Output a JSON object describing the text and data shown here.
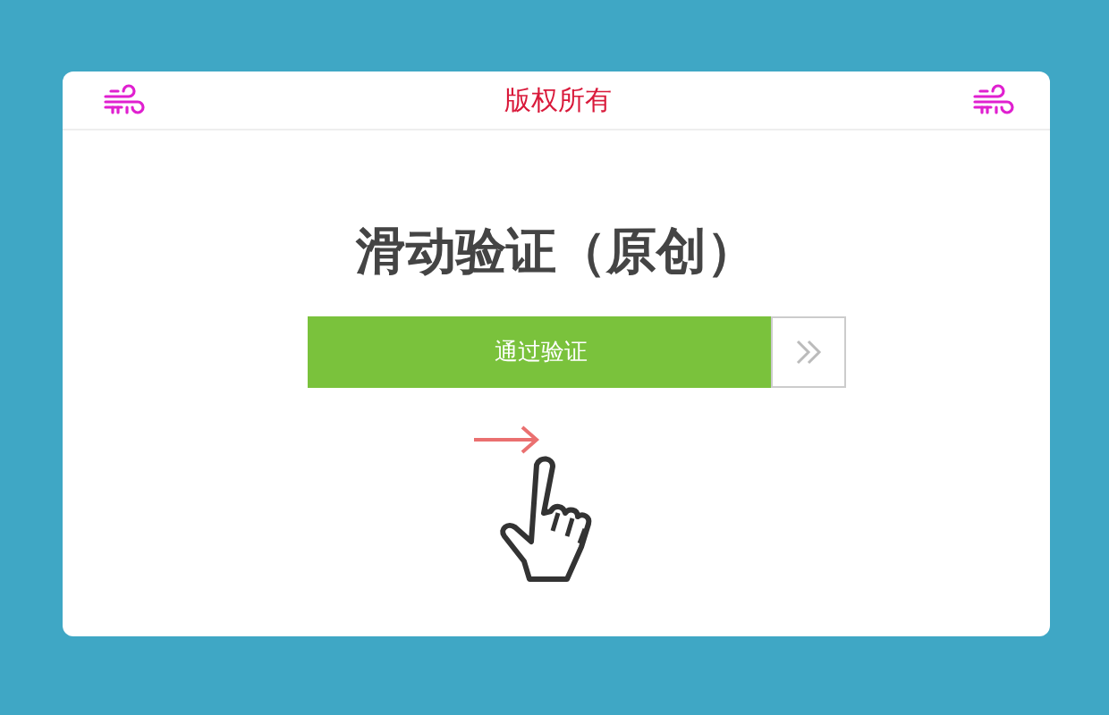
{
  "header": {
    "title": "版权所有"
  },
  "heading": "滑动验证（原创）",
  "slider": {
    "label": "通过验证",
    "level": 0.87
  }
}
